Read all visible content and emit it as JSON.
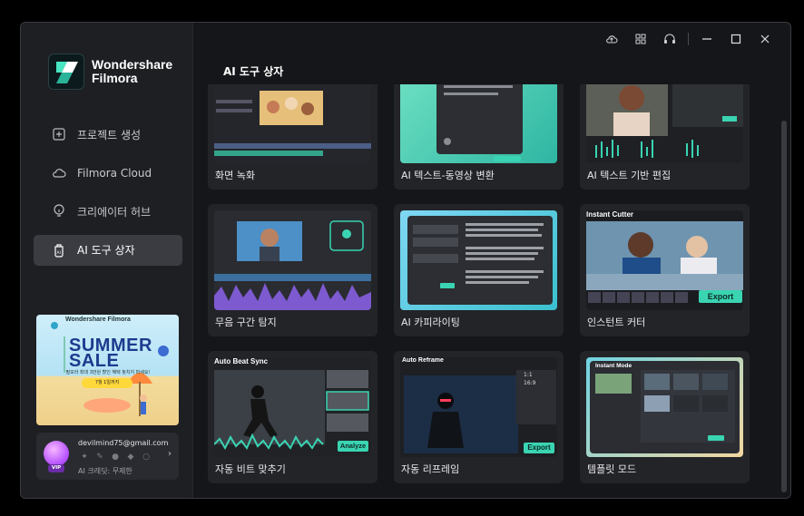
{
  "app": {
    "brand_line1": "Wondershare",
    "brand_line2": "Filmora"
  },
  "nav": [
    {
      "label": "프로젝트 생성",
      "icon": "plus-square-icon"
    },
    {
      "label": "Filmora Cloud",
      "icon": "cloud-icon"
    },
    {
      "label": "크리에이터 허브",
      "icon": "lightbulb-icon"
    },
    {
      "label": "AI 도구 상자",
      "icon": "ai-toolbox-icon",
      "active": true
    }
  ],
  "promo": {
    "brand": "Wondershare Filmora",
    "title_line1": "SUMMER",
    "title_line2": "SALE",
    "subtitle": "필모라 최대 3만원 할인 혜택 놓치지 마세요!",
    "button": "7월 1일까지"
  },
  "account": {
    "email": "devilmind75@gmail.com",
    "badge": "VIP",
    "credits": "AI 크레딧: 무제한"
  },
  "main": {
    "title": "AI 도구 상자"
  },
  "cards": [
    {
      "label": "화면 녹화"
    },
    {
      "label": "AI 텍스트-동영상 변환"
    },
    {
      "label": "AI 텍스트 기반 편집"
    },
    {
      "label": "무음 구간 탐지"
    },
    {
      "label": "AI 카피라이팅"
    },
    {
      "label": "인스턴트 커터",
      "overlay": "Instant Cutter",
      "button": "Export"
    },
    {
      "label": "자동 비트 맞추기",
      "overlay": "Auto Beat Sync",
      "button": "Analyze"
    },
    {
      "label": "자동 리프레임",
      "overlay": "Auto Reframe",
      "button": "Export",
      "ratios": [
        "1:1",
        "16:9"
      ]
    },
    {
      "label": "템플릿 모드",
      "overlay": "Instant Mode"
    }
  ],
  "colors": {
    "accent": "#3ad4b2",
    "sidebar": "#1e1f23",
    "card": "#232428",
    "active_nav": "#3a3c42"
  }
}
